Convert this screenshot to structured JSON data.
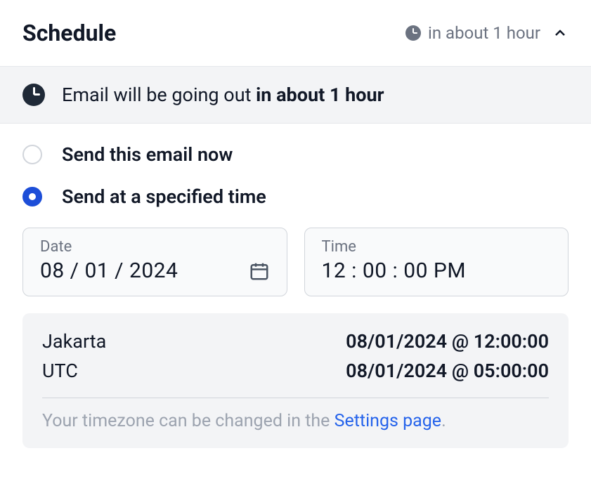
{
  "header": {
    "title": "Schedule",
    "status": "in about 1 hour"
  },
  "banner": {
    "text_prefix": "Email will be going out ",
    "text_strong": "in about 1 hour"
  },
  "options": {
    "send_now_label": "Send this email now",
    "send_scheduled_label": "Send at a specified time",
    "selected": "scheduled"
  },
  "inputs": {
    "date_label": "Date",
    "date_value": "08 / 01 / 2024",
    "time_label": "Time",
    "time_value": "12 : 00 : 00   PM"
  },
  "timezones": {
    "rows": [
      {
        "label": "Jakarta",
        "value": "08/01/2024 @ 12:00:00"
      },
      {
        "label": "UTC",
        "value": "08/01/2024 @ 05:00:00"
      }
    ],
    "note_prefix": "Your timezone can be changed in the ",
    "note_link": "Settings page",
    "note_suffix": "."
  }
}
